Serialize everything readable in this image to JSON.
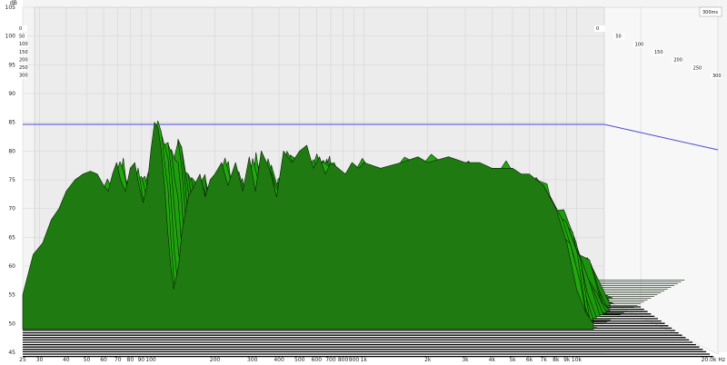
{
  "chart_data": {
    "type": "area",
    "title": "",
    "xlabel": "",
    "ylabel": "dB",
    "x_unit": "Hz",
    "x_scale": "log",
    "xlim": [
      25,
      20000
    ],
    "ylim": [
      45,
      105
    ],
    "y_ticks": [
      "105",
      "100",
      "95",
      "90",
      "85",
      "80",
      "75",
      "70",
      "65",
      "60",
      "55",
      "50",
      "45"
    ],
    "x_ticks": [
      "25",
      "30",
      "40",
      "50",
      "60",
      "70",
      "80",
      "90",
      "100",
      "200",
      "300",
      "400",
      "500",
      "600",
      "700",
      "800",
      "900",
      "1k",
      "2k",
      "3k",
      "4k",
      "5k",
      "6k",
      "7k",
      "8k",
      "9k",
      "10k",
      "20.0k Hz"
    ],
    "time_axis": {
      "label": "300ms",
      "ticks": [
        "0",
        "50",
        "100",
        "150",
        "200",
        "250",
        "300"
      ],
      "max_ms": 300
    },
    "reference_line_db": 84,
    "grid": true,
    "colors": {
      "fill": "#1f7a12",
      "stroke": "#0b1f06",
      "wall": "#ececec",
      "floor_stripes": "#000000",
      "reference_line": "#4a4ad8"
    },
    "envelope_front": [
      [
        25,
        55
      ],
      [
        28,
        62
      ],
      [
        31,
        64
      ],
      [
        34,
        68
      ],
      [
        37,
        70
      ],
      [
        40,
        73
      ],
      [
        44,
        75
      ],
      [
        48,
        76
      ],
      [
        52,
        76.5
      ],
      [
        56,
        76
      ],
      [
        60,
        74
      ],
      [
        63,
        73
      ],
      [
        66,
        76
      ],
      [
        69,
        78
      ],
      [
        72,
        75
      ],
      [
        76,
        73
      ],
      [
        80,
        77
      ],
      [
        84,
        78
      ],
      [
        88,
        74
      ],
      [
        92,
        71
      ],
      [
        96,
        74
      ],
      [
        100,
        80
      ],
      [
        104,
        85
      ],
      [
        108,
        84
      ],
      [
        112,
        80
      ],
      [
        116,
        74
      ],
      [
        120,
        66
      ],
      [
        124,
        60
      ],
      [
        128,
        56
      ],
      [
        135,
        60
      ],
      [
        140,
        66
      ],
      [
        150,
        72
      ],
      [
        160,
        74
      ],
      [
        170,
        76
      ],
      [
        180,
        72
      ],
      [
        190,
        75
      ],
      [
        200,
        76
      ],
      [
        215,
        78
      ],
      [
        230,
        74
      ],
      [
        250,
        78
      ],
      [
        270,
        73
      ],
      [
        290,
        79
      ],
      [
        310,
        73
      ],
      [
        330,
        80
      ],
      [
        360,
        77
      ],
      [
        390,
        72
      ],
      [
        420,
        80
      ],
      [
        460,
        78
      ],
      [
        500,
        80
      ],
      [
        540,
        81
      ],
      [
        580,
        77
      ],
      [
        620,
        79
      ],
      [
        660,
        76
      ],
      [
        700,
        78
      ],
      [
        760,
        77
      ],
      [
        820,
        76
      ],
      [
        880,
        78
      ],
      [
        950,
        77
      ],
      [
        1000,
        78
      ],
      [
        1200,
        77
      ],
      [
        1500,
        78
      ],
      [
        1800,
        79
      ],
      [
        2000,
        78
      ],
      [
        2500,
        79
      ],
      [
        3000,
        78
      ],
      [
        3500,
        78
      ],
      [
        4000,
        77
      ],
      [
        4500,
        77
      ],
      [
        5000,
        77
      ],
      [
        5500,
        76
      ],
      [
        6000,
        76
      ],
      [
        7000,
        74
      ],
      [
        8000,
        70
      ],
      [
        9000,
        64
      ],
      [
        10000,
        56
      ],
      [
        11000,
        52
      ],
      [
        12000,
        50
      ]
    ],
    "decay_slices_ms": [
      0,
      50,
      100,
      150,
      200,
      250,
      300
    ]
  }
}
